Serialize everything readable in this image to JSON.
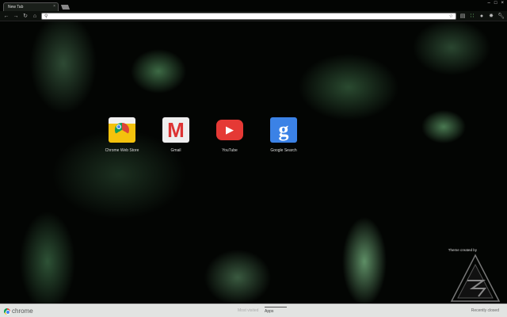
{
  "tab": {
    "title": "New Tab"
  },
  "toolbar": {
    "back": "←",
    "forward": "→",
    "reload": "↻",
    "home": "⌂",
    "omnibox_value": "",
    "star": "☆"
  },
  "window": {
    "min": "–",
    "max": "□",
    "close": "×"
  },
  "apps": [
    {
      "label": "Chrome Web Store",
      "icon": "chrome-web-store-icon"
    },
    {
      "label": "Gmail",
      "icon": "gmail-icon"
    },
    {
      "label": "YouTube",
      "icon": "youtube-icon"
    },
    {
      "label": "Google Search",
      "icon": "google-search-icon"
    }
  ],
  "theme_credit": "Theme created by",
  "footer": {
    "brand": "chrome",
    "tabs": [
      "Most visited",
      "Apps"
    ],
    "selected": "Apps",
    "recently_closed": "Recently closed"
  }
}
